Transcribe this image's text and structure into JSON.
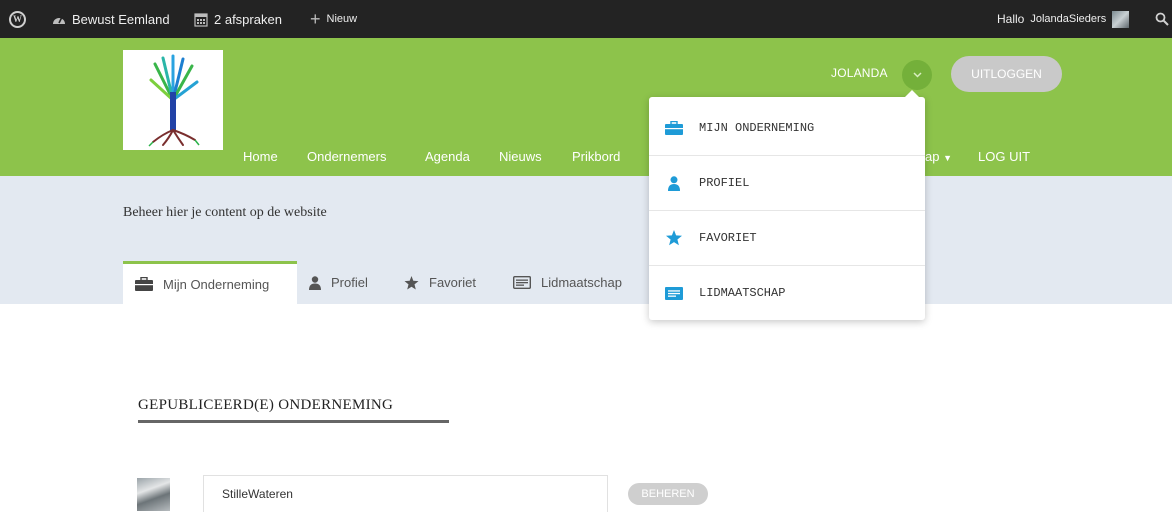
{
  "admin_bar": {
    "site_name": "Bewust Eemland",
    "appointments": "2 afspraken",
    "new_label": "Nieuw",
    "greeting": "Hallo",
    "username": "JolandaSieders"
  },
  "header": {
    "user_name": "JOLANDA",
    "logout_button": "UITLOGGEN",
    "nav": {
      "home": "Home",
      "ondernemers": "Ondernemers",
      "agenda": "Agenda",
      "nieuws": "Nieuws",
      "prikbord": "Prikbord",
      "partial": "ap",
      "log_uit": "LOG UIT"
    }
  },
  "band": {
    "intro": "Beheer hier je content op de website",
    "tabs": {
      "mijn_onderneming": "Mijn Onderneming",
      "profiel": "Profiel",
      "favoriet": "Favoriet",
      "lidmaatschap": "Lidmaatschap"
    }
  },
  "dropdown": {
    "mijn_onderneming": "MIJN ONDERNEMING",
    "profiel": "PROFIEL",
    "favoriet": "FAVORIET",
    "lidmaatschap": "LIDMAATSCHAP"
  },
  "content": {
    "section_title": "GEPUBLICEERD(E) ONDERNEMING",
    "business_name": "StilleWateren",
    "manage_button": "BEHEREN"
  },
  "colors": {
    "header_green": "#8dc34b",
    "admin_bar": "#232323",
    "band_blue": "#e3e9f1",
    "icon_blue": "#1e9bd7"
  },
  "icons": [
    "wordpress-icon",
    "dashboard-icon",
    "calendar-icon",
    "plus-icon",
    "search-icon",
    "briefcase-icon",
    "user-icon",
    "star-icon",
    "card-icon",
    "chevron-down-icon"
  ]
}
